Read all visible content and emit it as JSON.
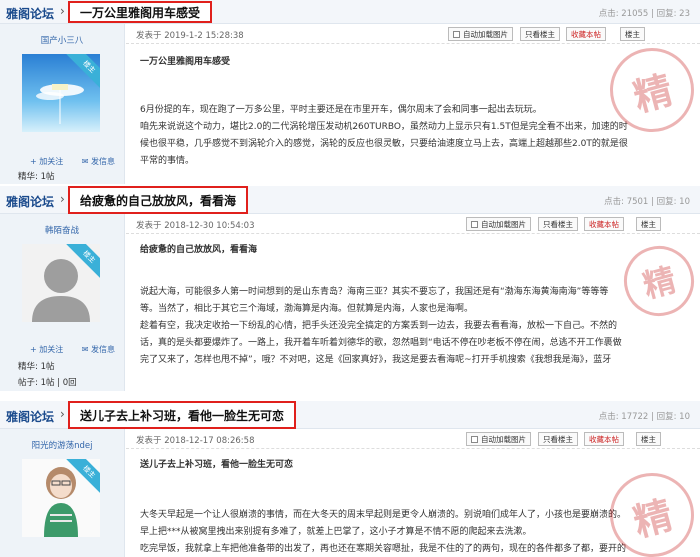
{
  "posts": [
    {
      "forum_name": "雅阁论坛",
      "title": "一万公里雅阁用车感受",
      "stats": "点击: 21055 | 回复: 23",
      "username": "国产小三八",
      "badge": "楼主",
      "follow": "加关注",
      "message": "发信息",
      "reward": "精华: 1帖",
      "posts_line": "",
      "date": "发表于 2019-1-2 15:28:38",
      "auto_load": "自动加载图片",
      "only_author": "只看楼主",
      "collect": "收藏本帖",
      "floor": "楼主",
      "subtitle": "一万公里雅阁用车感受",
      "paragraphs": [
        "6月份提的车，现在跑了一万多公里，平时主要还是在市里开车，偶尔周末了会和同事一起出去玩玩。",
        "咱先来说说这个动力，堪比2.0的二代涡轮增压发动机260TURBO，虽然动力上显示只有1.5T但是完全看不出来，加速的时",
        "候也很平稳，几乎感觉不到涡轮介入的感觉，涡轮的反应也很灵敏，只要给油速度立马上去，高端上超越那些2.0T的就是很",
        "平常的事情。"
      ],
      "stamp": "精"
    },
    {
      "forum_name": "雅阁论坛",
      "title": "给疲惫的自己放放风，看看海",
      "stats": "点击: 7501 | 回复: 10",
      "username": "韩陌奋战",
      "badge": "楼主",
      "follow": "加关注",
      "message": "发信息",
      "reward": "精华: 1帖",
      "posts_line": "帖子: 1帖 | 0回",
      "date": "发表于 2018-12-30 10:54:03",
      "auto_load": "自动加载图片",
      "only_author": "只看楼主",
      "collect": "收藏本帖",
      "floor": "楼主",
      "subtitle": "给疲惫的自己放放风，看看海",
      "paragraphs": [
        "说起大海，可能很多人第一时间想到的是山东青岛？海南三亚？其实不要忘了，我国还是有“渤海东海黄海南海”等等等",
        "等。当然了，相比于其它三个海域，渤海算是内海。但就算是内海，人家也是海啊。",
        "趁着有空，我决定收拾一下纷乱的心情，把手头还没完全搞定的方案丢到一边去，我要去看看海，放松一下自己。不然的",
        "话，真的是头都要爆炸了。一路上，我开着车听着刘德华的歌，忽然唱到“电话不停在吵老板不停在闹，总逃不开工作裹做",
        "完了又来了，怎样也甩不掉”，哦？不对吧，这是《回家真好》，我这是要去看海呢~打开手机搜索《我想我是海》，蓝牙"
      ],
      "stamp": "精"
    },
    {
      "forum_name": "雅阁论坛",
      "title": "送儿子去上补习班，看他一脸生无可恋",
      "stats": "点击: 17722 | 回复: 10",
      "username": "阳光的游荡ndej",
      "badge": "楼主",
      "follow": "",
      "message": "",
      "reward": "",
      "posts_line": "",
      "date": "发表于 2018-12-17 08:26:58",
      "auto_load": "自动加载图片",
      "only_author": "只看楼主",
      "collect": "收藏本帖",
      "floor": "楼主",
      "subtitle": "送儿子去上补习班，看他一脸生无可恋",
      "paragraphs": [
        "大冬天早起是一个让人很崩溃的事情，而在大冬天的周末早起则是更令人崩溃的。别说咱们成年人了，小孩也是要崩溃的。",
        "早上把***从被窝里拽出来别提有多难了，就差上巴掌了，这小子才算是不情不愿的爬起来去洗漱。",
        "吃完早饭，我就拿上车把他准备带的出发了，再也还在寒期关容嗯扯，我是不住的了的两句，现在的各件都多了都，要开的"
      ],
      "stamp": "精"
    }
  ]
}
